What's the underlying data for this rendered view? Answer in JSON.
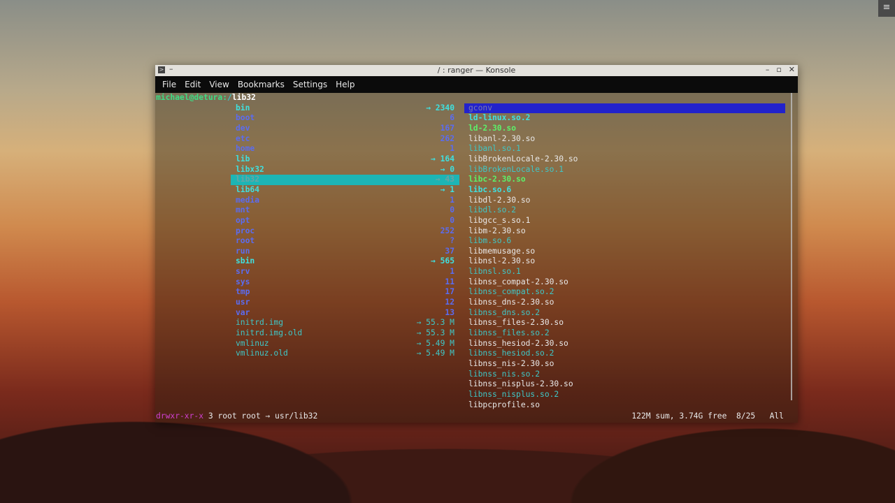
{
  "window": {
    "title": "/ : ranger — Konsole"
  },
  "menubar": [
    "File",
    "Edit",
    "View",
    "Bookmarks",
    "Settings",
    "Help"
  ],
  "prompt": {
    "user": "michael@detura",
    "sep": ":",
    "path": "/",
    "current": "lib32"
  },
  "col_parent": [
    {
      "name": "bin",
      "val": "→ 2340",
      "kind": "link"
    },
    {
      "name": "boot",
      "val": "6",
      "kind": "dir"
    },
    {
      "name": "dev",
      "val": "167",
      "kind": "dir"
    },
    {
      "name": "etc",
      "val": "262",
      "kind": "dir"
    },
    {
      "name": "home",
      "val": "1",
      "kind": "dir"
    },
    {
      "name": "lib",
      "val": "→ 164",
      "kind": "link"
    },
    {
      "name": "libx32",
      "val": "→ 0",
      "kind": "link"
    },
    {
      "name": "lib32",
      "val": "→ 43",
      "kind": "selected"
    },
    {
      "name": "lib64",
      "val": "→ 1",
      "kind": "link"
    },
    {
      "name": "media",
      "val": "1",
      "kind": "dir"
    },
    {
      "name": "mnt",
      "val": "0",
      "kind": "dir"
    },
    {
      "name": "opt",
      "val": "0",
      "kind": "dir"
    },
    {
      "name": "proc",
      "val": "252",
      "kind": "dir"
    },
    {
      "name": "root",
      "val": "?",
      "kind": "dir"
    },
    {
      "name": "run",
      "val": "37",
      "kind": "dir"
    },
    {
      "name": "sbin",
      "val": "→ 565",
      "kind": "link"
    },
    {
      "name": "srv",
      "val": "1",
      "kind": "dir"
    },
    {
      "name": "sys",
      "val": "11",
      "kind": "dir"
    },
    {
      "name": "tmp",
      "val": "17",
      "kind": "dir"
    },
    {
      "name": "usr",
      "val": "12",
      "kind": "dir"
    },
    {
      "name": "var",
      "val": "13",
      "kind": "dir"
    },
    {
      "name": "initrd.img",
      "val": "→ 55.3 M",
      "kind": "filelink"
    },
    {
      "name": "initrd.img.old",
      "val": "→ 55.3 M",
      "kind": "filelink"
    },
    {
      "name": "vmlinuz",
      "val": "→ 5.49 M",
      "kind": "filelink"
    },
    {
      "name": "vmlinuz.old",
      "val": "→ 5.49 M",
      "kind": "filelink"
    }
  ],
  "col_current": [
    {
      "name": "gconv",
      "kind": "selected"
    },
    {
      "name": "ld-linux.so.2",
      "kind": "cyanb"
    },
    {
      "name": "ld-2.30.so",
      "kind": "green"
    },
    {
      "name": "libanl-2.30.so",
      "kind": "plain"
    },
    {
      "name": "libanl.so.1",
      "kind": "cyan"
    },
    {
      "name": "libBrokenLocale-2.30.so",
      "kind": "plain"
    },
    {
      "name": "libBrokenLocale.so.1",
      "kind": "cyan"
    },
    {
      "name": "libc-2.30.so",
      "kind": "green"
    },
    {
      "name": "libc.so.6",
      "kind": "cyanb"
    },
    {
      "name": "libdl-2.30.so",
      "kind": "plain"
    },
    {
      "name": "libdl.so.2",
      "kind": "cyan"
    },
    {
      "name": "libgcc_s.so.1",
      "kind": "plain"
    },
    {
      "name": "libm-2.30.so",
      "kind": "plain"
    },
    {
      "name": "libm.so.6",
      "kind": "cyan"
    },
    {
      "name": "libmemusage.so",
      "kind": "plain"
    },
    {
      "name": "libnsl-2.30.so",
      "kind": "plain"
    },
    {
      "name": "libnsl.so.1",
      "kind": "cyan"
    },
    {
      "name": "libnss_compat-2.30.so",
      "kind": "plain"
    },
    {
      "name": "libnss_compat.so.2",
      "kind": "cyan"
    },
    {
      "name": "libnss_dns-2.30.so",
      "kind": "plain"
    },
    {
      "name": "libnss_dns.so.2",
      "kind": "cyan"
    },
    {
      "name": "libnss_files-2.30.so",
      "kind": "plain"
    },
    {
      "name": "libnss_files.so.2",
      "kind": "cyan"
    },
    {
      "name": "libnss_hesiod-2.30.so",
      "kind": "plain"
    },
    {
      "name": "libnss_hesiod.so.2",
      "kind": "cyan"
    },
    {
      "name": "libnss_nis-2.30.so",
      "kind": "plain"
    },
    {
      "name": "libnss_nis.so.2",
      "kind": "cyan"
    },
    {
      "name": "libnss_nisplus-2.30.so",
      "kind": "plain"
    },
    {
      "name": "libnss_nisplus.so.2",
      "kind": "cyan"
    },
    {
      "name": "libpcprofile.so",
      "kind": "plain"
    }
  ],
  "status": {
    "perm": "drwxr-xr-x",
    "info": " 3 root root → usr/lib32",
    "right": "122M sum, 3.74G free  8/25   All"
  }
}
